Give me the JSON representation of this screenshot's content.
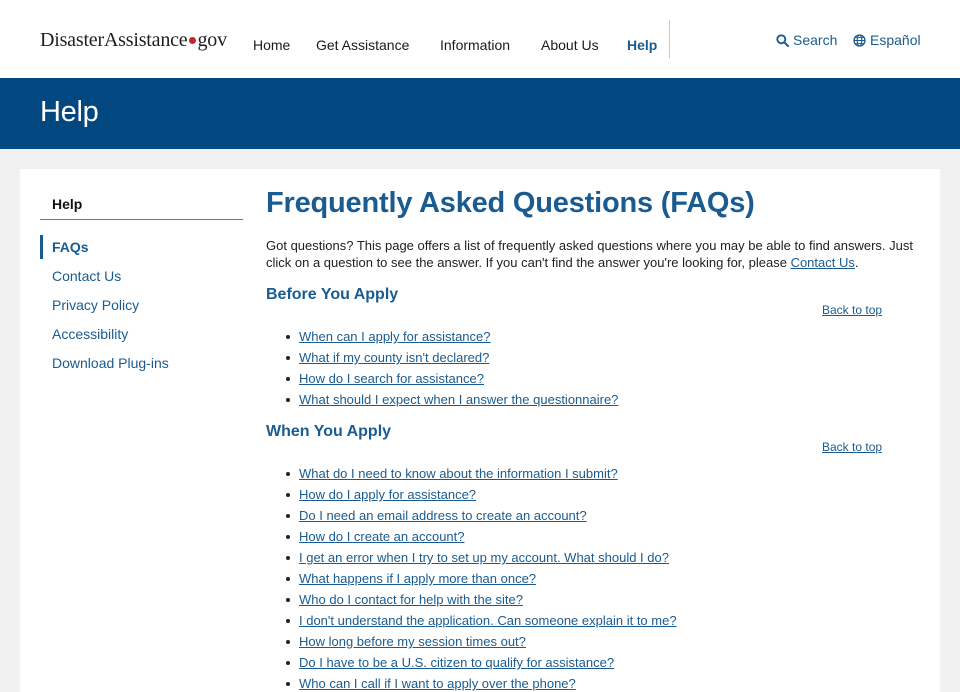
{
  "header": {
    "logo": {
      "part1": "Disaster",
      "part2": "Assistance",
      "part3": "gov"
    },
    "nav": [
      "Home",
      "Get Assistance",
      "Information",
      "About Us",
      "Help"
    ],
    "active_nav": "Help",
    "search_label": "Search",
    "language_label": "Español"
  },
  "banner": {
    "title": "Help"
  },
  "sidebar": {
    "heading": "Help",
    "items": [
      "FAQs",
      "Contact Us",
      "Privacy Policy",
      "Accessibility",
      "Download Plug-ins"
    ],
    "active_item": "FAQs"
  },
  "main": {
    "title": "Frequently Asked Questions (FAQs)",
    "intro_text": "Got questions? This page offers a list of frequently asked questions where you may be able to find answers. Just click on a question to see the answer. If you can't find the answer you're looking for, please ",
    "intro_link": "Contact Us",
    "intro_end": ".",
    "back_to_top": "Back to top",
    "sections": [
      {
        "title": "Before You Apply",
        "questions": [
          "When can I apply for assistance?",
          "What if my county isn't declared?",
          "How do I search for assistance?",
          "What should I expect when I answer the questionnaire?"
        ]
      },
      {
        "title": "When You Apply",
        "questions": [
          "What do I need to know about the information I submit?",
          "How do I apply for assistance?",
          "Do I need an email address to create an account?",
          "How do I create an account?",
          "I get an error when I try to set up my account. What should I do?",
          "What happens if I apply more than once?",
          "Who do I contact for help with the site?",
          "I don't understand the application. Can someone explain it to me?",
          "How long before my session times out?",
          "Do I have to be a U.S. citizen to qualify for assistance?",
          "Who can I call if I want to apply over the phone?"
        ]
      }
    ]
  },
  "colors": {
    "brand_blue": "#02477f",
    "link_blue": "#1a5c91",
    "logo_dot_red": "#c2272d",
    "page_bg": "#f1f1f1"
  },
  "icons": {
    "search": "search-icon",
    "language": "globe-icon"
  }
}
